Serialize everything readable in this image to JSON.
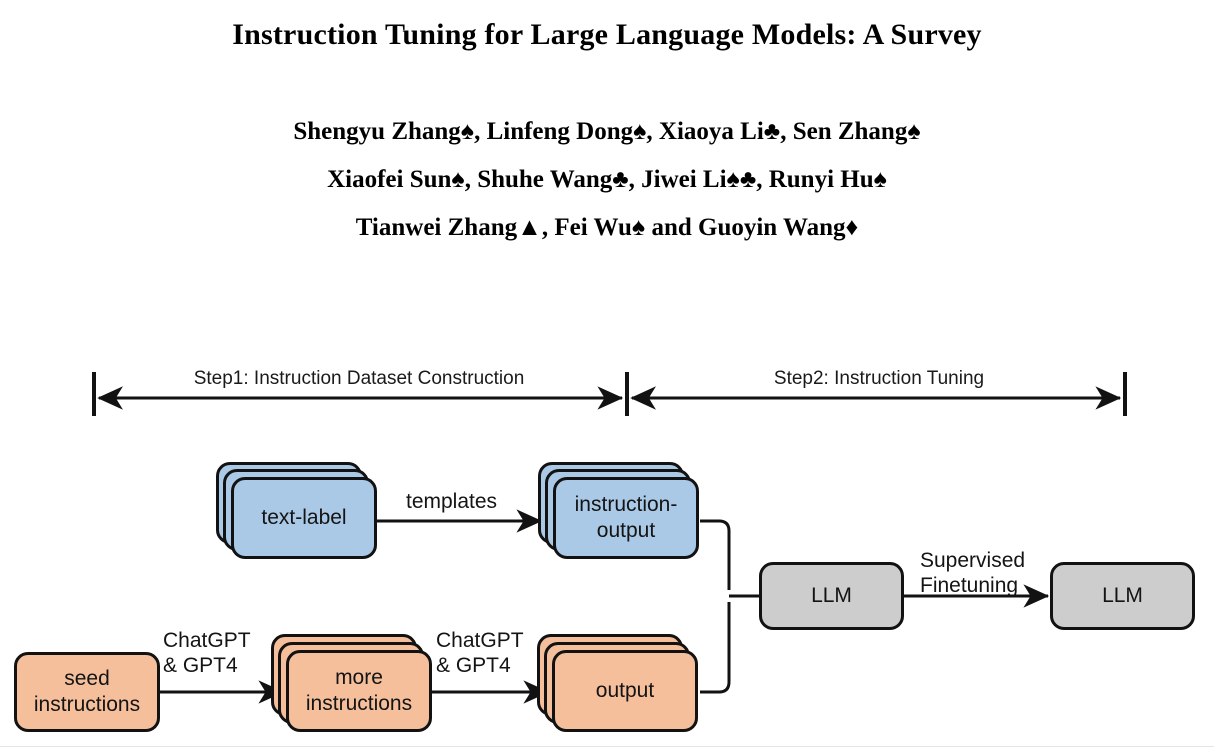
{
  "paper": {
    "title": "Instruction Tuning for Large Language Models: A Survey",
    "authors": {
      "line1": "Shengyu Zhang♠, Linfeng Dong♠, Xiaoya Li♣, Sen Zhang♠",
      "line2": "Xiaofei Sun♠, Shuhe Wang♣, Jiwei Li♠♣, Runyi Hu♠",
      "line3": "Tianwei Zhang▲, Fei Wu♠ and Guoyin Wang♦"
    }
  },
  "figure": {
    "steps": {
      "step1": "Step1: Instruction Dataset Construction",
      "step2": "Step2: Instruction Tuning"
    },
    "nodes": {
      "text_label": "text-label",
      "instruction_output": "instruction-\noutput",
      "seed_instructions": "seed\ninstructions",
      "more_instructions": "more\ninstructions",
      "output": "output",
      "llm_base": "LLM",
      "llm_tuned": "LLM"
    },
    "edges": {
      "templates": "templates",
      "chatgpt_gpt4_a": "ChatGPT\n& GPT4",
      "chatgpt_gpt4_b": "ChatGPT\n& GPT4",
      "supervised_finetuning": "Supervised\nFinetuning"
    },
    "colors": {
      "blue": "#aac9e6",
      "orange": "#f5bf9c",
      "gray": "#cdcdcd",
      "stroke": "#121212"
    }
  }
}
